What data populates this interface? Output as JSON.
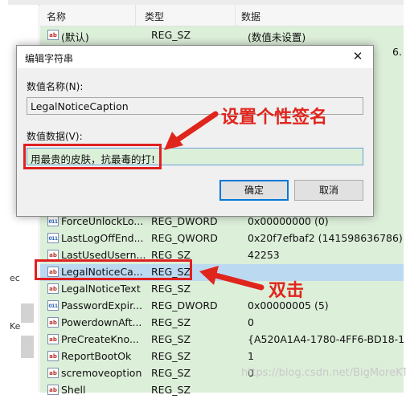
{
  "registry": {
    "columns": [
      "名称",
      "类型",
      "数据"
    ],
    "tree_fragments": [
      "ec",
      "Ke"
    ],
    "rows_top": [
      {
        "name": "(默认)",
        "type": "REG_SZ",
        "data": "(数值未设置)",
        "icon": "string"
      },
      {
        "name": "",
        "type": "",
        "data": "6.",
        "icon": "string"
      }
    ],
    "rows": [
      {
        "name": "ForceUnlockLo...",
        "type": "REG_DWORD",
        "data": "0x00000000 (0)",
        "icon": "binary"
      },
      {
        "name": "LastLogOffEnd...",
        "type": "REG_QWORD",
        "data": "0x20f7efbaf2 (141598636786)",
        "icon": "binary"
      },
      {
        "name": "LastUsedUsern...",
        "type": "REG_SZ",
        "data": "42253",
        "icon": "string"
      },
      {
        "name": "LegalNoticeCa...",
        "type": "REG_SZ",
        "data": "",
        "icon": "string",
        "selected": true
      },
      {
        "name": "LegalNoticeText",
        "type": "REG_SZ",
        "data": "",
        "icon": "string"
      },
      {
        "name": "PasswordExpir...",
        "type": "REG_DWORD",
        "data": "0x00000005 (5)",
        "icon": "binary"
      },
      {
        "name": "PowerdownAft...",
        "type": "REG_SZ",
        "data": "0",
        "icon": "string"
      },
      {
        "name": "PreCreateKno...",
        "type": "REG_SZ",
        "data": "{A520A1A4-1780-4FF6-BD18-1",
        "icon": "string"
      },
      {
        "name": "ReportBootOk",
        "type": "REG_SZ",
        "data": "1",
        "icon": "string"
      },
      {
        "name": "scremoveoption",
        "type": "REG_SZ",
        "data": "0",
        "icon": "string"
      },
      {
        "name": "Shell",
        "type": "REG_SZ",
        "data": "",
        "icon": "string"
      }
    ]
  },
  "dialog": {
    "title": "编辑字符串",
    "close_glyph": "✕",
    "name_label": "数值名称(N):",
    "name_value": "LegalNoticeCaption",
    "data_label": "数值数据(V):",
    "data_value": "用最贵的皮肤，抗最毒的打!",
    "ok_label": "确定",
    "cancel_label": "取消"
  },
  "annotations": {
    "set_signature": "设置个性签名",
    "double_click": "双击",
    "color": "#e0251d"
  },
  "watermark": "https://blog.csdn.net/BigMoreKT"
}
